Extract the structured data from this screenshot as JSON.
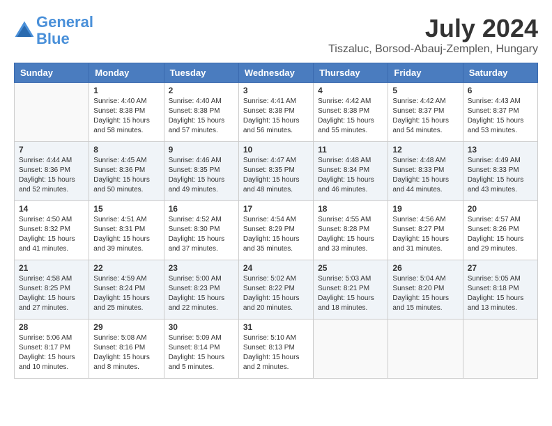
{
  "header": {
    "logo_line1": "General",
    "logo_line2": "Blue",
    "month_title": "July 2024",
    "location": "Tiszaluc, Borsod-Abauj-Zemplen, Hungary"
  },
  "weekdays": [
    "Sunday",
    "Monday",
    "Tuesday",
    "Wednesday",
    "Thursday",
    "Friday",
    "Saturday"
  ],
  "weeks": [
    [
      {
        "day": "",
        "sunrise": "",
        "sunset": "",
        "daylight": ""
      },
      {
        "day": "1",
        "sunrise": "Sunrise: 4:40 AM",
        "sunset": "Sunset: 8:38 PM",
        "daylight": "Daylight: 15 hours and 58 minutes."
      },
      {
        "day": "2",
        "sunrise": "Sunrise: 4:40 AM",
        "sunset": "Sunset: 8:38 PM",
        "daylight": "Daylight: 15 hours and 57 minutes."
      },
      {
        "day": "3",
        "sunrise": "Sunrise: 4:41 AM",
        "sunset": "Sunset: 8:38 PM",
        "daylight": "Daylight: 15 hours and 56 minutes."
      },
      {
        "day": "4",
        "sunrise": "Sunrise: 4:42 AM",
        "sunset": "Sunset: 8:38 PM",
        "daylight": "Daylight: 15 hours and 55 minutes."
      },
      {
        "day": "5",
        "sunrise": "Sunrise: 4:42 AM",
        "sunset": "Sunset: 8:37 PM",
        "daylight": "Daylight: 15 hours and 54 minutes."
      },
      {
        "day": "6",
        "sunrise": "Sunrise: 4:43 AM",
        "sunset": "Sunset: 8:37 PM",
        "daylight": "Daylight: 15 hours and 53 minutes."
      }
    ],
    [
      {
        "day": "7",
        "sunrise": "Sunrise: 4:44 AM",
        "sunset": "Sunset: 8:36 PM",
        "daylight": "Daylight: 15 hours and 52 minutes."
      },
      {
        "day": "8",
        "sunrise": "Sunrise: 4:45 AM",
        "sunset": "Sunset: 8:36 PM",
        "daylight": "Daylight: 15 hours and 50 minutes."
      },
      {
        "day": "9",
        "sunrise": "Sunrise: 4:46 AM",
        "sunset": "Sunset: 8:35 PM",
        "daylight": "Daylight: 15 hours and 49 minutes."
      },
      {
        "day": "10",
        "sunrise": "Sunrise: 4:47 AM",
        "sunset": "Sunset: 8:35 PM",
        "daylight": "Daylight: 15 hours and 48 minutes."
      },
      {
        "day": "11",
        "sunrise": "Sunrise: 4:48 AM",
        "sunset": "Sunset: 8:34 PM",
        "daylight": "Daylight: 15 hours and 46 minutes."
      },
      {
        "day": "12",
        "sunrise": "Sunrise: 4:48 AM",
        "sunset": "Sunset: 8:33 PM",
        "daylight": "Daylight: 15 hours and 44 minutes."
      },
      {
        "day": "13",
        "sunrise": "Sunrise: 4:49 AM",
        "sunset": "Sunset: 8:33 PM",
        "daylight": "Daylight: 15 hours and 43 minutes."
      }
    ],
    [
      {
        "day": "14",
        "sunrise": "Sunrise: 4:50 AM",
        "sunset": "Sunset: 8:32 PM",
        "daylight": "Daylight: 15 hours and 41 minutes."
      },
      {
        "day": "15",
        "sunrise": "Sunrise: 4:51 AM",
        "sunset": "Sunset: 8:31 PM",
        "daylight": "Daylight: 15 hours and 39 minutes."
      },
      {
        "day": "16",
        "sunrise": "Sunrise: 4:52 AM",
        "sunset": "Sunset: 8:30 PM",
        "daylight": "Daylight: 15 hours and 37 minutes."
      },
      {
        "day": "17",
        "sunrise": "Sunrise: 4:54 AM",
        "sunset": "Sunset: 8:29 PM",
        "daylight": "Daylight: 15 hours and 35 minutes."
      },
      {
        "day": "18",
        "sunrise": "Sunrise: 4:55 AM",
        "sunset": "Sunset: 8:28 PM",
        "daylight": "Daylight: 15 hours and 33 minutes."
      },
      {
        "day": "19",
        "sunrise": "Sunrise: 4:56 AM",
        "sunset": "Sunset: 8:27 PM",
        "daylight": "Daylight: 15 hours and 31 minutes."
      },
      {
        "day": "20",
        "sunrise": "Sunrise: 4:57 AM",
        "sunset": "Sunset: 8:26 PM",
        "daylight": "Daylight: 15 hours and 29 minutes."
      }
    ],
    [
      {
        "day": "21",
        "sunrise": "Sunrise: 4:58 AM",
        "sunset": "Sunset: 8:25 PM",
        "daylight": "Daylight: 15 hours and 27 minutes."
      },
      {
        "day": "22",
        "sunrise": "Sunrise: 4:59 AM",
        "sunset": "Sunset: 8:24 PM",
        "daylight": "Daylight: 15 hours and 25 minutes."
      },
      {
        "day": "23",
        "sunrise": "Sunrise: 5:00 AM",
        "sunset": "Sunset: 8:23 PM",
        "daylight": "Daylight: 15 hours and 22 minutes."
      },
      {
        "day": "24",
        "sunrise": "Sunrise: 5:02 AM",
        "sunset": "Sunset: 8:22 PM",
        "daylight": "Daylight: 15 hours and 20 minutes."
      },
      {
        "day": "25",
        "sunrise": "Sunrise: 5:03 AM",
        "sunset": "Sunset: 8:21 PM",
        "daylight": "Daylight: 15 hours and 18 minutes."
      },
      {
        "day": "26",
        "sunrise": "Sunrise: 5:04 AM",
        "sunset": "Sunset: 8:20 PM",
        "daylight": "Daylight: 15 hours and 15 minutes."
      },
      {
        "day": "27",
        "sunrise": "Sunrise: 5:05 AM",
        "sunset": "Sunset: 8:18 PM",
        "daylight": "Daylight: 15 hours and 13 minutes."
      }
    ],
    [
      {
        "day": "28",
        "sunrise": "Sunrise: 5:06 AM",
        "sunset": "Sunset: 8:17 PM",
        "daylight": "Daylight: 15 hours and 10 minutes."
      },
      {
        "day": "29",
        "sunrise": "Sunrise: 5:08 AM",
        "sunset": "Sunset: 8:16 PM",
        "daylight": "Daylight: 15 hours and 8 minutes."
      },
      {
        "day": "30",
        "sunrise": "Sunrise: 5:09 AM",
        "sunset": "Sunset: 8:14 PM",
        "daylight": "Daylight: 15 hours and 5 minutes."
      },
      {
        "day": "31",
        "sunrise": "Sunrise: 5:10 AM",
        "sunset": "Sunset: 8:13 PM",
        "daylight": "Daylight: 15 hours and 2 minutes."
      },
      {
        "day": "",
        "sunrise": "",
        "sunset": "",
        "daylight": ""
      },
      {
        "day": "",
        "sunrise": "",
        "sunset": "",
        "daylight": ""
      },
      {
        "day": "",
        "sunrise": "",
        "sunset": "",
        "daylight": ""
      }
    ]
  ]
}
